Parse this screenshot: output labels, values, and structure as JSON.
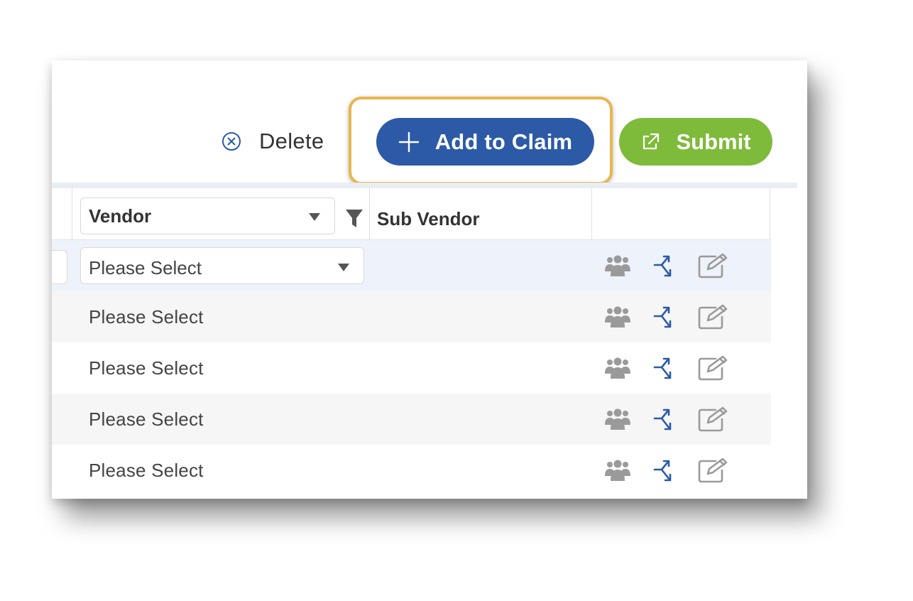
{
  "toolbar": {
    "delete_label": "Delete",
    "add_to_claim_label": "Add to Claim",
    "submit_label": "Submit"
  },
  "grid": {
    "columns": {
      "vendor": "Vendor",
      "sub_vendor": "Sub Vendor"
    },
    "rows": [
      {
        "vendor_value": "Please Select",
        "editable": true
      },
      {
        "vendor_value": "Please Select",
        "editable": false
      },
      {
        "vendor_value": "Please Select",
        "editable": false
      },
      {
        "vendor_value": "Please Select",
        "editable": false
      },
      {
        "vendor_value": "Please Select",
        "editable": false
      }
    ]
  },
  "icons": {
    "delete": "circle-x-icon",
    "add": "plus-icon",
    "submit": "external-link-icon",
    "filter": "filter-icon",
    "row_actions": [
      "people-icon",
      "split-icon",
      "edit-icon"
    ]
  },
  "colors": {
    "add_button": "#2c5aa6",
    "submit_button": "#7fbb3a",
    "highlight_border": "#e8b54e",
    "delete_icon": "#2c5aa6",
    "split_icon": "#2c5aa6",
    "grey_icon": "#9a9a9a"
  }
}
